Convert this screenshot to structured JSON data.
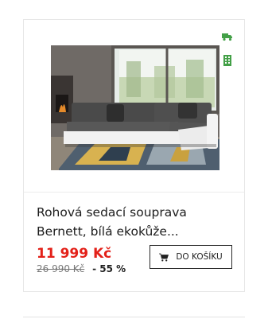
{
  "product": {
    "title_line1": "Rohová sedací souprava",
    "title_line2": "Bernett, bílá ekokůže...",
    "price": "11 999 Kč",
    "old_price": "26 990 Kč",
    "discount": "- 55 %",
    "cart_button_label": "DO KOŠÍKU",
    "image_alt": "Rohová sedací souprava Bernett"
  },
  "icons": {
    "delivery": "truck-icon",
    "store": "store-icon",
    "cart": "cart-icon"
  },
  "colors": {
    "price": "#e32119",
    "badge": "#43a047",
    "text": "#1d1d1d"
  }
}
